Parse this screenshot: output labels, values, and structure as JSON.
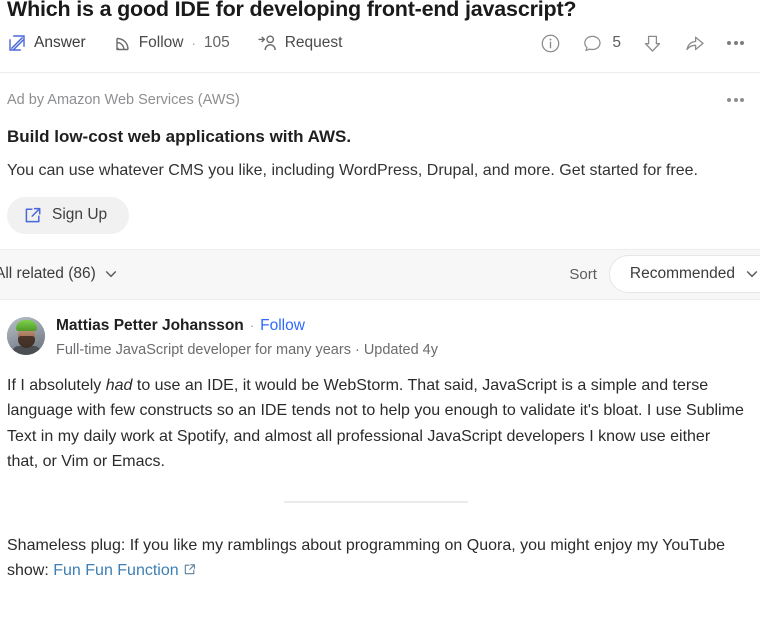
{
  "question": {
    "title": "Which is a good IDE for developing front-end javascript?",
    "actions": {
      "answer": {
        "label": "Answer",
        "icon": "pencil-square-icon"
      },
      "follow": {
        "label": "Follow",
        "separator": "·",
        "count": "105",
        "icon": "follow-rss-icon"
      },
      "request": {
        "label": "Request",
        "icon": "person-arrow-icon"
      }
    },
    "meta_icons": {
      "info": "info-circle-icon",
      "comment": {
        "icon": "comment-bubble-icon",
        "count": "5"
      },
      "downvote": "downvote-arrow-icon",
      "share": "share-arrow-icon",
      "more": "more-dots-icon"
    }
  },
  "ad": {
    "label": "Ad by Amazon Web Services (AWS)",
    "more_icon": "more-dots-icon",
    "title": "Build low-cost web applications with AWS.",
    "body": "You can use whatever CMS you like, including WordPress, Drupal, and more. Get started for free.",
    "cta": {
      "label": "Sign Up",
      "icon": "external-link-icon"
    }
  },
  "sort_bar": {
    "all_related": "All related (86)",
    "all_related_icon": "chevron-down-icon",
    "sort_label": "Sort",
    "sort_value": "Recommended",
    "sort_icon": "chevron-down-icon"
  },
  "answer": {
    "avatar": "user-avatar",
    "author_name": "Mattias Petter Johansson",
    "author_separator": "·",
    "follow_link": "Follow",
    "credential": "Full-time JavaScript developer for many years · Updated 4y",
    "body_part1": "If I absolutely ",
    "body_emphasis": "had",
    "body_part2": " to use an IDE, it would be WebStorm. That said, JavaScript is a simple and terse language with few constructs so an IDE tends not to help you enough to validate it's bloat. I use Sublime Text in my daily work at Spotify, and almost all professional JavaScript developers I know use either that, or Vim or Emacs.",
    "plug_text": "Shameless plug: If you like my ramblings about programming on Quora, you might enjoy my YouTube show: ",
    "plug_link": "Fun Fun Function",
    "plug_link_icon": "external-link-icon"
  },
  "colors": {
    "link_blue": "#2e69ff",
    "muted_link_blue": "#3b7fb5",
    "icon_blue": "#4a67d8",
    "text": "#282829",
    "muted": "#8e8f91",
    "bar_bg": "#f7f7f8"
  }
}
